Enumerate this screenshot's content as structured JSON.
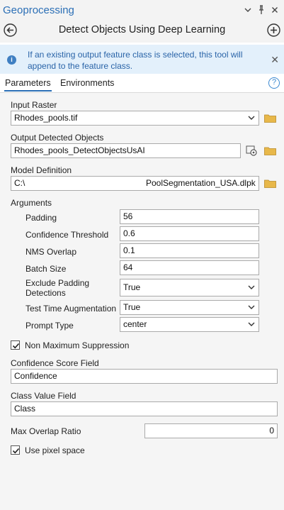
{
  "header": {
    "pane_title": "Geoprocessing",
    "tool_title": "Detect Objects Using Deep Learning"
  },
  "banner": {
    "message": "If an existing output feature class is selected, this tool will append to the feature class."
  },
  "tabs": {
    "parameters": "Parameters",
    "environments": "Environments"
  },
  "params": {
    "input_raster_label": "Input Raster",
    "input_raster_value": "Rhodes_pools.tif",
    "output_label": "Output Detected Objects",
    "output_value": "Rhodes_pools_DetectObjectsUsAI",
    "model_label": "Model Definition",
    "model_prefix": "C:\\",
    "model_suffix": "PoolSegmentation_USA.dlpk"
  },
  "arguments": {
    "label": "Arguments",
    "items": [
      {
        "label": "Padding",
        "value": "56"
      },
      {
        "label": "Confidence Threshold",
        "value": "0.6"
      },
      {
        "label": "NMS Overlap",
        "value": "0.1"
      },
      {
        "label": "Batch Size",
        "value": "64"
      },
      {
        "label": "Exclude Padding Detections",
        "value": "True"
      },
      {
        "label": "Test Time Augmentation",
        "value": "True"
      },
      {
        "label": "Prompt Type",
        "value": "center"
      }
    ]
  },
  "options": {
    "nms_label": "Non Maximum Suppression",
    "nms_checked": true,
    "confidence_field_label": "Confidence Score Field",
    "confidence_field_value": "Confidence",
    "class_field_label": "Class Value Field",
    "class_field_value": "Class",
    "max_overlap_label": "Max Overlap Ratio",
    "max_overlap_value": "0",
    "pixel_space_label": "Use pixel space",
    "pixel_space_checked": true
  },
  "colors": {
    "accent": "#2b6fb6",
    "banner_bg": "#e3f0fb",
    "folder": "#e8b84a"
  },
  "icons": [
    "dropdown-arrow-icon",
    "back-arrow-icon",
    "pin-icon",
    "close-icon",
    "add-icon",
    "info-icon",
    "help-icon",
    "folder-icon",
    "gear-icon",
    "checkbox-icon",
    "chevron-down-icon"
  ]
}
